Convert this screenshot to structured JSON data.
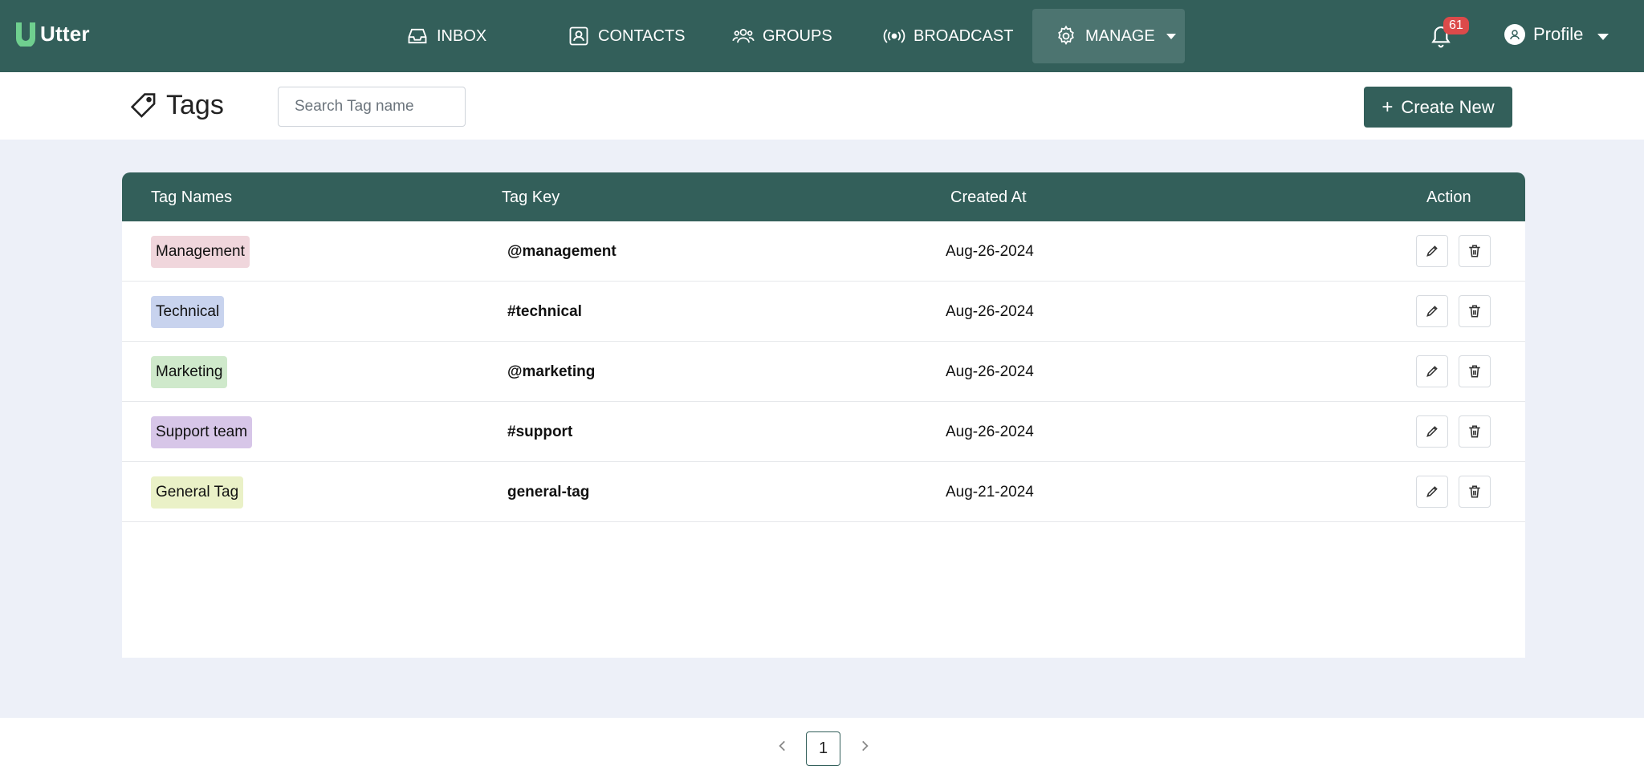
{
  "brand": {
    "name": "Utter",
    "logo_icon": "u-logo-icon",
    "logo_color": "#6fcf8f"
  },
  "colors": {
    "primary": "#335f5a",
    "active_nav": "#4c7470",
    "page_bg": "#edf0f8",
    "badge": "#dc4a4a"
  },
  "nav": {
    "inbox": "INBOX",
    "contacts": "CONTACTS",
    "groups": "GROUPS",
    "broadcast": "BROADCAST",
    "manage": "MANAGE"
  },
  "notifications": {
    "count": "61"
  },
  "profile": {
    "label": "Profile"
  },
  "page": {
    "title": "Tags",
    "search_placeholder": "Search Tag name",
    "create_label": "Create New"
  },
  "table": {
    "headers": {
      "name": "Tag Names",
      "key": "Tag Key",
      "created": "Created At",
      "action": "Action"
    },
    "rows": [
      {
        "name": "Management",
        "key": "@management",
        "created": "Aug-26-2024",
        "color": "#f0d6dc"
      },
      {
        "name": "Technical",
        "key": "#technical",
        "created": "Aug-26-2024",
        "color": "#c8d3ee"
      },
      {
        "name": "Marketing",
        "key": "@marketing",
        "created": "Aug-26-2024",
        "color": "#cfe9cb"
      },
      {
        "name": "Support team",
        "key": "#support",
        "created": "Aug-26-2024",
        "color": "#d7c6e8"
      },
      {
        "name": "General Tag",
        "key": "general-tag",
        "created": "Aug-21-2024",
        "color": "#eaf1c7"
      }
    ]
  },
  "pagination": {
    "current": "1"
  }
}
